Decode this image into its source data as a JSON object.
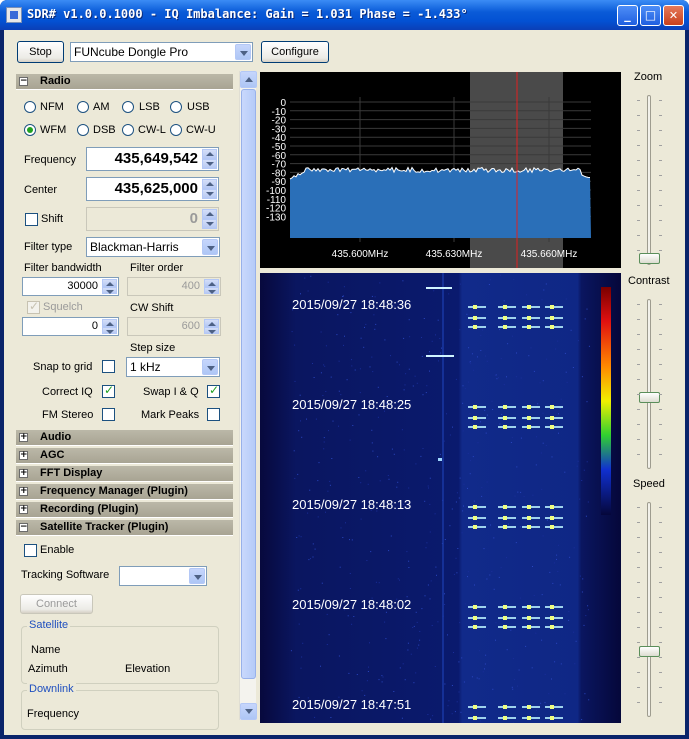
{
  "window": {
    "title": "SDR# v1.0.0.1000 - IQ Imbalance: Gain = 1.031 Phase = -1.433°",
    "minimize": "_",
    "maximize": "□",
    "close": "✕"
  },
  "toolbar": {
    "stop_label": "Stop",
    "device": "FUNcube Dongle Pro",
    "configure_label": "Configure"
  },
  "sections": {
    "radio": "Radio",
    "audio": "Audio",
    "agc": "AGC",
    "fft": "FFT Display",
    "freq_manager": "Frequency Manager (Plugin)",
    "recording": "Recording (Plugin)",
    "sat_tracker": "Satellite Tracker (Plugin)"
  },
  "radio": {
    "modes": [
      "NFM",
      "AM",
      "LSB",
      "USB",
      "WFM",
      "DSB",
      "CW-L",
      "CW-U"
    ],
    "selected_mode": "WFM",
    "frequency_label": "Frequency",
    "frequency": "435,649,542",
    "center_label": "Center",
    "center": "435,625,000",
    "shift_label": "Shift",
    "shift": "0",
    "filter_type_label": "Filter type",
    "filter_type": "Blackman-Harris",
    "filter_bw_label": "Filter bandwidth",
    "filter_bw": "30000",
    "filter_order_label": "Filter order",
    "filter_order": "400",
    "squelch_label": "Squelch",
    "squelch": "0",
    "cw_shift_label": "CW Shift",
    "cw_shift": "600",
    "step_size_label": "Step size",
    "step_size": "1 kHz",
    "snap_label": "Snap to grid",
    "correct_iq_label": "Correct IQ",
    "swap_iq_label": "Swap I & Q",
    "fm_stereo_label": "FM Stereo",
    "mark_peaks_label": "Mark Peaks"
  },
  "sat": {
    "enable_label": "Enable",
    "tracking_label": "Tracking Software",
    "tracking_value": "",
    "connect_label": "Connect",
    "satellite_group": "Satellite",
    "name_label": "Name",
    "azimuth_label": "Azimuth",
    "elevation_label": "Elevation",
    "downlink_group": "Downlink",
    "frequency_label": "Frequency"
  },
  "spectrum": {
    "db_labels": [
      "0",
      "-10",
      "-20",
      "-30",
      "-40",
      "-50",
      "-60",
      "-70",
      "-80",
      "-90",
      "-100",
      "-110",
      "-120",
      "-130"
    ],
    "freq_labels": [
      "435.600MHz",
      "435.630MHz",
      "435.660MHz"
    ]
  },
  "waterfall": {
    "timestamps": [
      "2015/09/27 18:48:36",
      "2015/09/27 18:48:25",
      "2015/09/27 18:48:13",
      "2015/09/27 18:48:02",
      "2015/09/27 18:47:51"
    ]
  },
  "sliders": {
    "zoom_label": "Zoom",
    "contrast_label": "Contrast",
    "speed_label": "Speed"
  },
  "colors": {
    "spectrum_fill": "#2a6fb8",
    "filter_band": "#4a4a4a",
    "center_line": "#e02020",
    "waterfall_bg": "#03042d"
  }
}
